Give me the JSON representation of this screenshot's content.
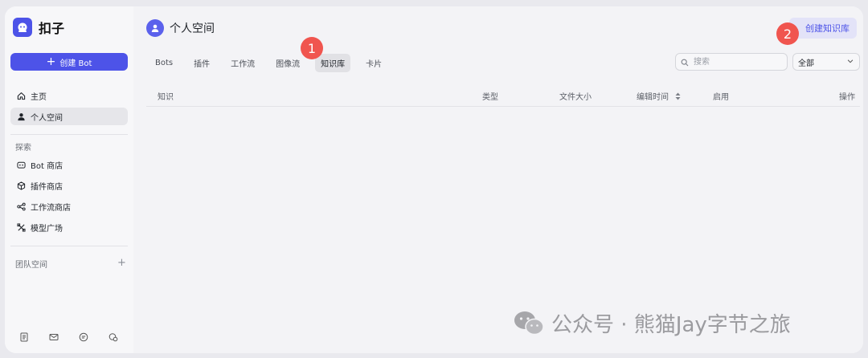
{
  "app": {
    "name": "扣子"
  },
  "sidebar": {
    "create_bot_label": "创建 Bot",
    "nav": [
      {
        "label": "主页",
        "icon": "home-icon"
      },
      {
        "label": "个人空间",
        "icon": "user-icon"
      }
    ],
    "explore_label": "探索",
    "explore_items": [
      {
        "label": "Bot 商店",
        "icon": "bot-icon"
      },
      {
        "label": "插件商店",
        "icon": "cube-icon"
      },
      {
        "label": "工作流商店",
        "icon": "workflow-icon"
      },
      {
        "label": "模型广场",
        "icon": "model-icon"
      }
    ],
    "team_label": "团队空间"
  },
  "main": {
    "title": "个人空间",
    "create_kb_label": "创建知识库",
    "tabs": [
      {
        "label": "Bots"
      },
      {
        "label": "插件"
      },
      {
        "label": "工作流"
      },
      {
        "label": "图像流"
      },
      {
        "label": "知识库"
      },
      {
        "label": "卡片"
      }
    ],
    "active_tab": "知识库",
    "search": {
      "placeholder": "搜索"
    },
    "filter": {
      "value": "全部"
    },
    "table": {
      "columns": [
        "知识",
        "类型",
        "文件大小",
        "编辑时间",
        "启用",
        "操作"
      ]
    }
  },
  "annotations": [
    {
      "number": "1"
    },
    {
      "number": "2"
    }
  ],
  "watermark": {
    "text": "公众号 · 熊猫Jay字节之旅"
  },
  "colors": {
    "accent": "#4d53e8",
    "badge": "#f0554f"
  }
}
